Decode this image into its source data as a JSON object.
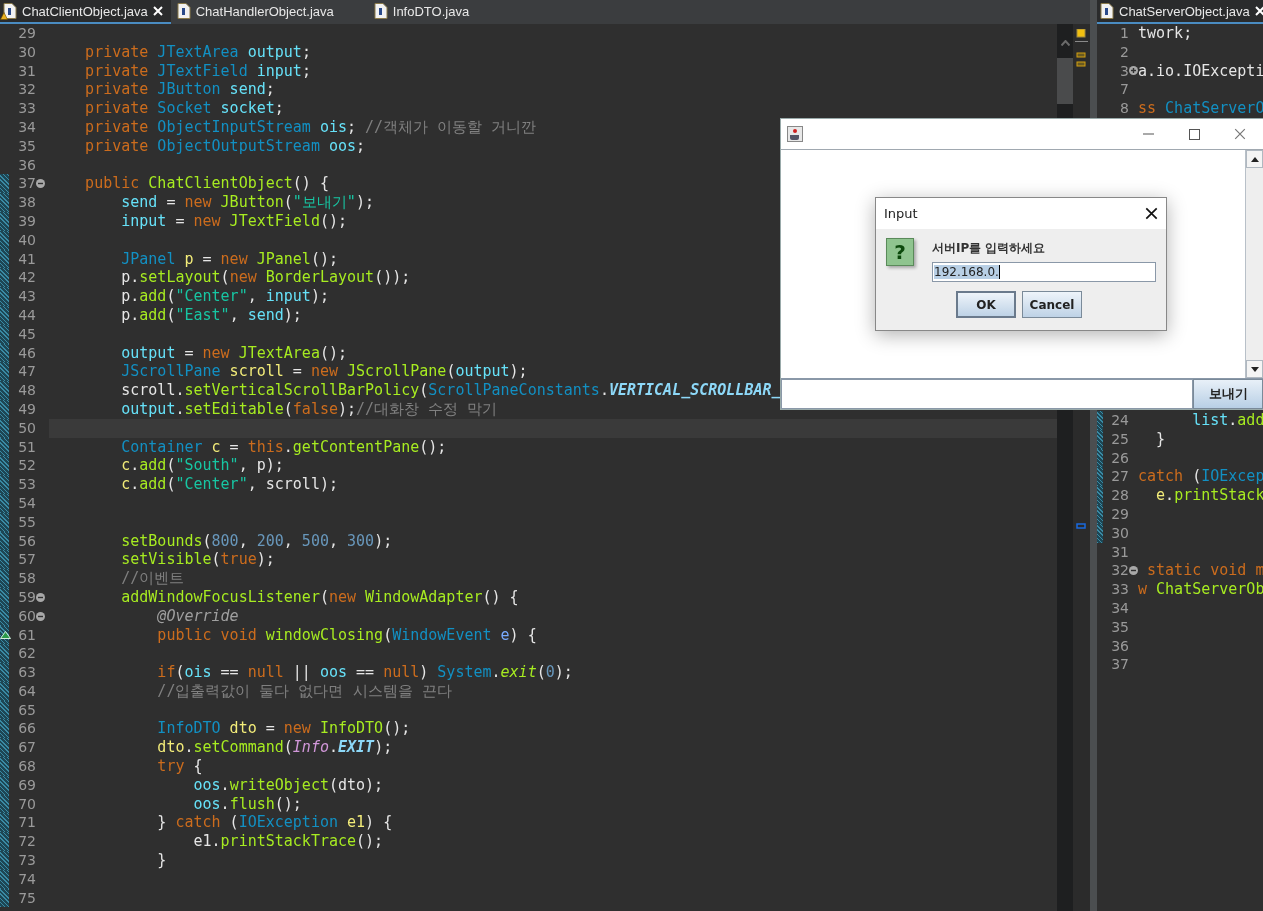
{
  "left_editor": {
    "tabs": [
      {
        "label": "ChatClientObject.java",
        "selected": true,
        "warning": true
      },
      {
        "label": "ChatHandlerObject.java",
        "selected": false,
        "warning": false
      },
      {
        "label": "InfoDTO.java",
        "selected": false,
        "warning": false
      }
    ],
    "lines": [
      {
        "number": "29",
        "changed": false,
        "current": false
      },
      {
        "number": "30",
        "changed": false,
        "current": false,
        "tokens": [
          {
            "kind": "kw",
            "text": "    private"
          },
          {
            "kind": "type",
            "text": " JTextArea"
          },
          {
            "kind": "field",
            "text": " output"
          },
          {
            "kind": "plain",
            "text": ";"
          }
        ]
      },
      {
        "number": "31",
        "changed": false,
        "current": false,
        "tokens": [
          {
            "kind": "kw",
            "text": "    private"
          },
          {
            "kind": "type",
            "text": " JTextField"
          },
          {
            "kind": "field",
            "text": " input"
          },
          {
            "kind": "plain",
            "text": ";"
          }
        ]
      },
      {
        "number": "32",
        "changed": false,
        "current": false,
        "tokens": [
          {
            "kind": "kw",
            "text": "    private"
          },
          {
            "kind": "type",
            "text": " JButton"
          },
          {
            "kind": "field",
            "text": " send"
          },
          {
            "kind": "plain",
            "text": ";"
          }
        ]
      },
      {
        "number": "33",
        "changed": false,
        "current": false,
        "tokens": [
          {
            "kind": "kw",
            "text": "    private"
          },
          {
            "kind": "type",
            "text": " Socket"
          },
          {
            "kind": "field",
            "text": " socket"
          },
          {
            "kind": "plain",
            "text": ";"
          }
        ]
      },
      {
        "number": "34",
        "changed": false,
        "current": false,
        "tokens": [
          {
            "kind": "kw",
            "text": "    private"
          },
          {
            "kind": "type",
            "text": " ObjectInputStream"
          },
          {
            "kind": "field",
            "text": " ois"
          },
          {
            "kind": "plain",
            "text": ";"
          },
          {
            "kind": "com",
            "text": " //객체가 이동할 거니깐"
          }
        ]
      },
      {
        "number": "35",
        "changed": false,
        "current": false,
        "tokens": [
          {
            "kind": "kw",
            "text": "    private"
          },
          {
            "kind": "type",
            "text": " ObjectOutputStream"
          },
          {
            "kind": "field",
            "text": " oos"
          },
          {
            "kind": "plain",
            "text": ";"
          }
        ]
      },
      {
        "number": "36",
        "changed": false,
        "current": false
      },
      {
        "number": "37",
        "changed": true,
        "current": false,
        "fold": {
          "collapsed": false
        },
        "tokens": [
          {
            "kind": "kw",
            "text": "    public"
          },
          {
            "kind": "method",
            "text": " ChatClientObject"
          },
          {
            "kind": "plain",
            "text": "() {"
          }
        ]
      },
      {
        "number": "38",
        "changed": true,
        "current": false,
        "tokens": [
          {
            "kind": "field",
            "text": "        send"
          },
          {
            "kind": "plain",
            "text": " ="
          },
          {
            "kind": "kw",
            "text": " new"
          },
          {
            "kind": "method",
            "text": " JButton"
          },
          {
            "kind": "plain",
            "text": "("
          },
          {
            "kind": "str",
            "text": "\"보내기\""
          },
          {
            "kind": "plain",
            "text": ");"
          }
        ]
      },
      {
        "number": "39",
        "changed": true,
        "current": false,
        "tokens": [
          {
            "kind": "field",
            "text": "        input"
          },
          {
            "kind": "plain",
            "text": " ="
          },
          {
            "kind": "kw",
            "text": " new"
          },
          {
            "kind": "method",
            "text": " JTextField"
          },
          {
            "kind": "plain",
            "text": "();"
          }
        ]
      },
      {
        "number": "40",
        "changed": true,
        "current": false
      },
      {
        "number": "41",
        "changed": true,
        "current": false,
        "tokens": [
          {
            "kind": "type",
            "text": "        JPanel"
          },
          {
            "kind": "local",
            "text": " p"
          },
          {
            "kind": "plain",
            "text": " ="
          },
          {
            "kind": "kw",
            "text": " new"
          },
          {
            "kind": "method",
            "text": " JPanel"
          },
          {
            "kind": "plain",
            "text": "();"
          }
        ]
      },
      {
        "number": "42",
        "changed": true,
        "current": false,
        "tokens": [
          {
            "kind": "plain",
            "text": "        p."
          },
          {
            "kind": "method",
            "text": "setLayout"
          },
          {
            "kind": "plain",
            "text": "("
          },
          {
            "kind": "kw",
            "text": "new"
          },
          {
            "kind": "method",
            "text": " BorderLayout"
          },
          {
            "kind": "plain",
            "text": "());"
          }
        ]
      },
      {
        "number": "43",
        "changed": true,
        "current": false,
        "tokens": [
          {
            "kind": "plain",
            "text": "        p."
          },
          {
            "kind": "method",
            "text": "add"
          },
          {
            "kind": "plain",
            "text": "("
          },
          {
            "kind": "str",
            "text": "\"Center\""
          },
          {
            "kind": "plain",
            "text": ","
          },
          {
            "kind": "field",
            "text": " input"
          },
          {
            "kind": "plain",
            "text": ");"
          }
        ]
      },
      {
        "number": "44",
        "changed": true,
        "current": false,
        "tokens": [
          {
            "kind": "plain",
            "text": "        p."
          },
          {
            "kind": "method",
            "text": "add"
          },
          {
            "kind": "plain",
            "text": "("
          },
          {
            "kind": "str",
            "text": "\"East\""
          },
          {
            "kind": "plain",
            "text": ","
          },
          {
            "kind": "field",
            "text": " send"
          },
          {
            "kind": "plain",
            "text": ");"
          }
        ]
      },
      {
        "number": "45",
        "changed": true,
        "current": false
      },
      {
        "number": "46",
        "changed": true,
        "current": false,
        "tokens": [
          {
            "kind": "field",
            "text": "        output"
          },
          {
            "kind": "plain",
            "text": " ="
          },
          {
            "kind": "kw",
            "text": " new"
          },
          {
            "kind": "method",
            "text": " JTextArea"
          },
          {
            "kind": "plain",
            "text": "();"
          }
        ]
      },
      {
        "number": "47",
        "changed": true,
        "current": false,
        "tokens": [
          {
            "kind": "type",
            "text": "        JScrollPane"
          },
          {
            "kind": "local",
            "text": " scroll"
          },
          {
            "kind": "plain",
            "text": " ="
          },
          {
            "kind": "kw",
            "text": " new"
          },
          {
            "kind": "method",
            "text": " JScrollPane"
          },
          {
            "kind": "plain",
            "text": "("
          },
          {
            "kind": "field",
            "text": "output"
          },
          {
            "kind": "plain",
            "text": ");"
          }
        ]
      },
      {
        "number": "48",
        "changed": true,
        "current": false,
        "tokens": [
          {
            "kind": "plain",
            "text": "        scroll."
          },
          {
            "kind": "method",
            "text": "setVerticalScrollBarPolicy"
          },
          {
            "kind": "plain",
            "text": "("
          },
          {
            "kind": "type",
            "text": "ScrollPaneConstants"
          },
          {
            "kind": "plain",
            "text": "."
          },
          {
            "kind": "const",
            "text": "VERTICAL_SCROLLBAR_"
          }
        ]
      },
      {
        "number": "49",
        "changed": true,
        "current": false,
        "tokens": [
          {
            "kind": "field",
            "text": "        output"
          },
          {
            "kind": "plain",
            "text": "."
          },
          {
            "kind": "method",
            "text": "setEditable"
          },
          {
            "kind": "plain",
            "text": "("
          },
          {
            "kind": "kw",
            "text": "false"
          },
          {
            "kind": "plain",
            "text": ");"
          },
          {
            "kind": "com",
            "text": "//대화창 수정 막기"
          }
        ]
      },
      {
        "number": "50",
        "changed": true,
        "current": true
      },
      {
        "number": "51",
        "changed": true,
        "current": false,
        "tokens": [
          {
            "kind": "type",
            "text": "        Container"
          },
          {
            "kind": "local",
            "text": " c"
          },
          {
            "kind": "plain",
            "text": " ="
          },
          {
            "kind": "kw",
            "text": " this"
          },
          {
            "kind": "plain",
            "text": "."
          },
          {
            "kind": "method",
            "text": "getContentPane"
          },
          {
            "kind": "plain",
            "text": "();"
          }
        ]
      },
      {
        "number": "52",
        "changed": true,
        "current": false,
        "tokens": [
          {
            "kind": "local",
            "text": "        c"
          },
          {
            "kind": "plain",
            "text": "."
          },
          {
            "kind": "method",
            "text": "add"
          },
          {
            "kind": "plain",
            "text": "("
          },
          {
            "kind": "str",
            "text": "\"South\""
          },
          {
            "kind": "plain",
            "text": ", p);"
          }
        ]
      },
      {
        "number": "53",
        "changed": true,
        "current": false,
        "tokens": [
          {
            "kind": "local",
            "text": "        c"
          },
          {
            "kind": "plain",
            "text": "."
          },
          {
            "kind": "method",
            "text": "add"
          },
          {
            "kind": "plain",
            "text": "("
          },
          {
            "kind": "str",
            "text": "\"Center\""
          },
          {
            "kind": "plain",
            "text": ", scroll);"
          }
        ]
      },
      {
        "number": "54",
        "changed": true,
        "current": false
      },
      {
        "number": "55",
        "changed": true,
        "current": false
      },
      {
        "number": "56",
        "changed": true,
        "current": false,
        "tokens": [
          {
            "kind": "method",
            "text": "        setBounds"
          },
          {
            "kind": "plain",
            "text": "("
          },
          {
            "kind": "num",
            "text": "800"
          },
          {
            "kind": "plain",
            "text": ","
          },
          {
            "kind": "num",
            "text": " 200"
          },
          {
            "kind": "plain",
            "text": ","
          },
          {
            "kind": "num",
            "text": " 500"
          },
          {
            "kind": "plain",
            "text": ","
          },
          {
            "kind": "num",
            "text": " 300"
          },
          {
            "kind": "plain",
            "text": ");"
          }
        ]
      },
      {
        "number": "57",
        "changed": true,
        "current": false,
        "tokens": [
          {
            "kind": "method",
            "text": "        setVisible"
          },
          {
            "kind": "plain",
            "text": "("
          },
          {
            "kind": "kw",
            "text": "true"
          },
          {
            "kind": "plain",
            "text": ");"
          }
        ]
      },
      {
        "number": "58",
        "changed": true,
        "current": false,
        "tokens": [
          {
            "kind": "com",
            "text": "        //이벤트"
          }
        ]
      },
      {
        "number": "59",
        "changed": true,
        "current": false,
        "fold": {
          "collapsed": false
        },
        "tokens": [
          {
            "kind": "method",
            "text": "        addWindowFocusListener"
          },
          {
            "kind": "plain",
            "text": "("
          },
          {
            "kind": "kw",
            "text": "new"
          },
          {
            "kind": "method",
            "text": " WindowAdapter"
          },
          {
            "kind": "plain",
            "text": "() {"
          }
        ]
      },
      {
        "number": "60",
        "changed": true,
        "current": false,
        "fold": {
          "collapsed": false
        },
        "tokens": [
          {
            "kind": "ann",
            "text": "            @Override"
          }
        ]
      },
      {
        "number": "61",
        "changed": true,
        "current": false,
        "override": true,
        "tokens": [
          {
            "kind": "kw",
            "text": "            public void"
          },
          {
            "kind": "method",
            "text": " windowClosing"
          },
          {
            "kind": "plain",
            "text": "("
          },
          {
            "kind": "type",
            "text": "WindowEvent"
          },
          {
            "kind": "param",
            "text": " e"
          },
          {
            "kind": "plain",
            "text": ") {"
          }
        ]
      },
      {
        "number": "62",
        "changed": true,
        "current": false
      },
      {
        "number": "63",
        "changed": true,
        "current": false,
        "tokens": [
          {
            "kind": "kw",
            "text": "            if"
          },
          {
            "kind": "plain",
            "text": "("
          },
          {
            "kind": "field",
            "text": "ois"
          },
          {
            "kind": "plain",
            "text": " =="
          },
          {
            "kind": "kw",
            "text": " null"
          },
          {
            "kind": "plain",
            "text": " ||"
          },
          {
            "kind": "field",
            "text": " oos"
          },
          {
            "kind": "plain",
            "text": " =="
          },
          {
            "kind": "kw",
            "text": " null"
          },
          {
            "kind": "plain",
            "text": ")"
          },
          {
            "kind": "type",
            "text": " System"
          },
          {
            "kind": "plain",
            "text": "."
          },
          {
            "kind": "static",
            "text": "exit"
          },
          {
            "kind": "plain",
            "text": "("
          },
          {
            "kind": "num",
            "text": "0"
          },
          {
            "kind": "plain",
            "text": ");"
          }
        ]
      },
      {
        "number": "64",
        "changed": true,
        "current": false,
        "tokens": [
          {
            "kind": "com",
            "text": "            //입출력값이 둘다 없다면 시스템을 끈다"
          }
        ]
      },
      {
        "number": "65",
        "changed": true,
        "current": false
      },
      {
        "number": "66",
        "changed": true,
        "current": false,
        "tokens": [
          {
            "kind": "type",
            "text": "            InfoDTO"
          },
          {
            "kind": "local",
            "text": " dto"
          },
          {
            "kind": "plain",
            "text": " ="
          },
          {
            "kind": "kw",
            "text": " new"
          },
          {
            "kind": "method",
            "text": " InfoDTO"
          },
          {
            "kind": "plain",
            "text": "();"
          }
        ]
      },
      {
        "number": "67",
        "changed": true,
        "current": false,
        "tokens": [
          {
            "kind": "local",
            "text": "            dto"
          },
          {
            "kind": "plain",
            "text": "."
          },
          {
            "kind": "method",
            "text": "setCommand"
          },
          {
            "kind": "plain",
            "text": "("
          },
          {
            "kind": "cls",
            "text": "Info"
          },
          {
            "kind": "plain",
            "text": "."
          },
          {
            "kind": "const",
            "text": "EXIT"
          },
          {
            "kind": "plain",
            "text": ");"
          }
        ]
      },
      {
        "number": "68",
        "changed": true,
        "current": false,
        "tokens": [
          {
            "kind": "kw",
            "text": "            try"
          },
          {
            "kind": "plain",
            "text": " {"
          }
        ]
      },
      {
        "number": "69",
        "changed": true,
        "current": false,
        "tokens": [
          {
            "kind": "field",
            "text": "                oos"
          },
          {
            "kind": "plain",
            "text": "."
          },
          {
            "kind": "method",
            "text": "writeObject"
          },
          {
            "kind": "plain",
            "text": "(dto);"
          }
        ]
      },
      {
        "number": "70",
        "changed": true,
        "current": false,
        "tokens": [
          {
            "kind": "field",
            "text": "                oos"
          },
          {
            "kind": "plain",
            "text": "."
          },
          {
            "kind": "method",
            "text": "flush"
          },
          {
            "kind": "plain",
            "text": "();"
          }
        ]
      },
      {
        "number": "71",
        "changed": true,
        "current": false,
        "tokens": [
          {
            "kind": "plain",
            "text": "            }"
          },
          {
            "kind": "kw",
            "text": " catch"
          },
          {
            "kind": "plain",
            "text": " ("
          },
          {
            "kind": "type",
            "text": "IOException"
          },
          {
            "kind": "local",
            "text": " e1"
          },
          {
            "kind": "plain",
            "text": ") {"
          }
        ]
      },
      {
        "number": "72",
        "changed": true,
        "current": false,
        "tokens": [
          {
            "kind": "plain",
            "text": "                e1."
          },
          {
            "kind": "method",
            "text": "printStackTrace"
          },
          {
            "kind": "plain",
            "text": "();"
          }
        ]
      },
      {
        "number": "73",
        "changed": true,
        "current": false,
        "tokens": [
          {
            "kind": "plain",
            "text": "            }"
          }
        ]
      },
      {
        "number": "74",
        "changed": true,
        "current": false
      },
      {
        "number": "75",
        "changed": true,
        "current": false
      }
    ]
  },
  "right_editor": {
    "tab": {
      "label": "ChatServerObject.java",
      "selected": true
    },
    "top_lines": [
      {
        "number": "1",
        "changed": false,
        "current": false,
        "tokens": [
          {
            "kind": "plain",
            "text": "twork;"
          }
        ]
      },
      {
        "number": "2",
        "changed": false,
        "current": false
      },
      {
        "number": "3",
        "changed": false,
        "current": false,
        "fold": {
          "collapsed": true
        },
        "tokens": [
          {
            "kind": "plain",
            "text": "a.io.IOExcepti"
          }
        ]
      },
      {
        "number": "7",
        "changed": false,
        "current": false
      },
      {
        "number": "8",
        "changed": false,
        "current": false,
        "tokens": [
          {
            "kind": "kw",
            "text": "ss"
          },
          {
            "kind": "type",
            "text": " ChatServerO"
          }
        ]
      }
    ],
    "bottom_lines": [
      {
        "number": "24",
        "changed": true,
        "current": false,
        "tokens": [
          {
            "kind": "field",
            "text": "      list"
          },
          {
            "kind": "plain",
            "text": "."
          },
          {
            "kind": "method",
            "text": "add"
          }
        ]
      },
      {
        "number": "25",
        "changed": true,
        "current": false,
        "tokens": [
          {
            "kind": "plain",
            "text": "  }"
          }
        ]
      },
      {
        "number": "26",
        "changed": true,
        "current": false
      },
      {
        "number": "27",
        "changed": true,
        "current": false,
        "tokens": [
          {
            "kind": "kw",
            "text": "catch"
          },
          {
            "kind": "plain",
            "text": " ("
          },
          {
            "kind": "type",
            "text": "IOExcep"
          }
        ]
      },
      {
        "number": "28",
        "changed": true,
        "current": false,
        "tokens": [
          {
            "kind": "local",
            "text": "  e"
          },
          {
            "kind": "plain",
            "text": "."
          },
          {
            "kind": "method",
            "text": "printStack"
          }
        ]
      },
      {
        "number": "29",
        "changed": true,
        "current": false
      },
      {
        "number": "30",
        "changed": true,
        "current": false
      },
      {
        "number": "31",
        "changed": false,
        "current": false
      },
      {
        "number": "32",
        "changed": false,
        "current": false,
        "fold": {
          "collapsed": false
        },
        "tokens": [
          {
            "kind": "kw",
            "text": " static void m"
          }
        ]
      },
      {
        "number": "33",
        "changed": false,
        "current": false,
        "tokens": [
          {
            "kind": "kw",
            "text": "w"
          },
          {
            "kind": "method",
            "text": " ChatServerOb"
          }
        ]
      },
      {
        "number": "34",
        "changed": false,
        "current": false
      },
      {
        "number": "35",
        "changed": false,
        "current": false
      },
      {
        "number": "36",
        "changed": false,
        "current": false
      },
      {
        "number": "37",
        "changed": false,
        "current": false
      }
    ]
  },
  "app_window": {
    "send_button": "보내기"
  },
  "input_dialog": {
    "title": "Input",
    "icon": "?",
    "prompt": "서버IP를 입력하세요",
    "value": "192.168.0.",
    "value_selected": true,
    "buttons": [
      {
        "label": "OK",
        "focused": true
      },
      {
        "label": "Cancel",
        "focused": false
      }
    ]
  }
}
